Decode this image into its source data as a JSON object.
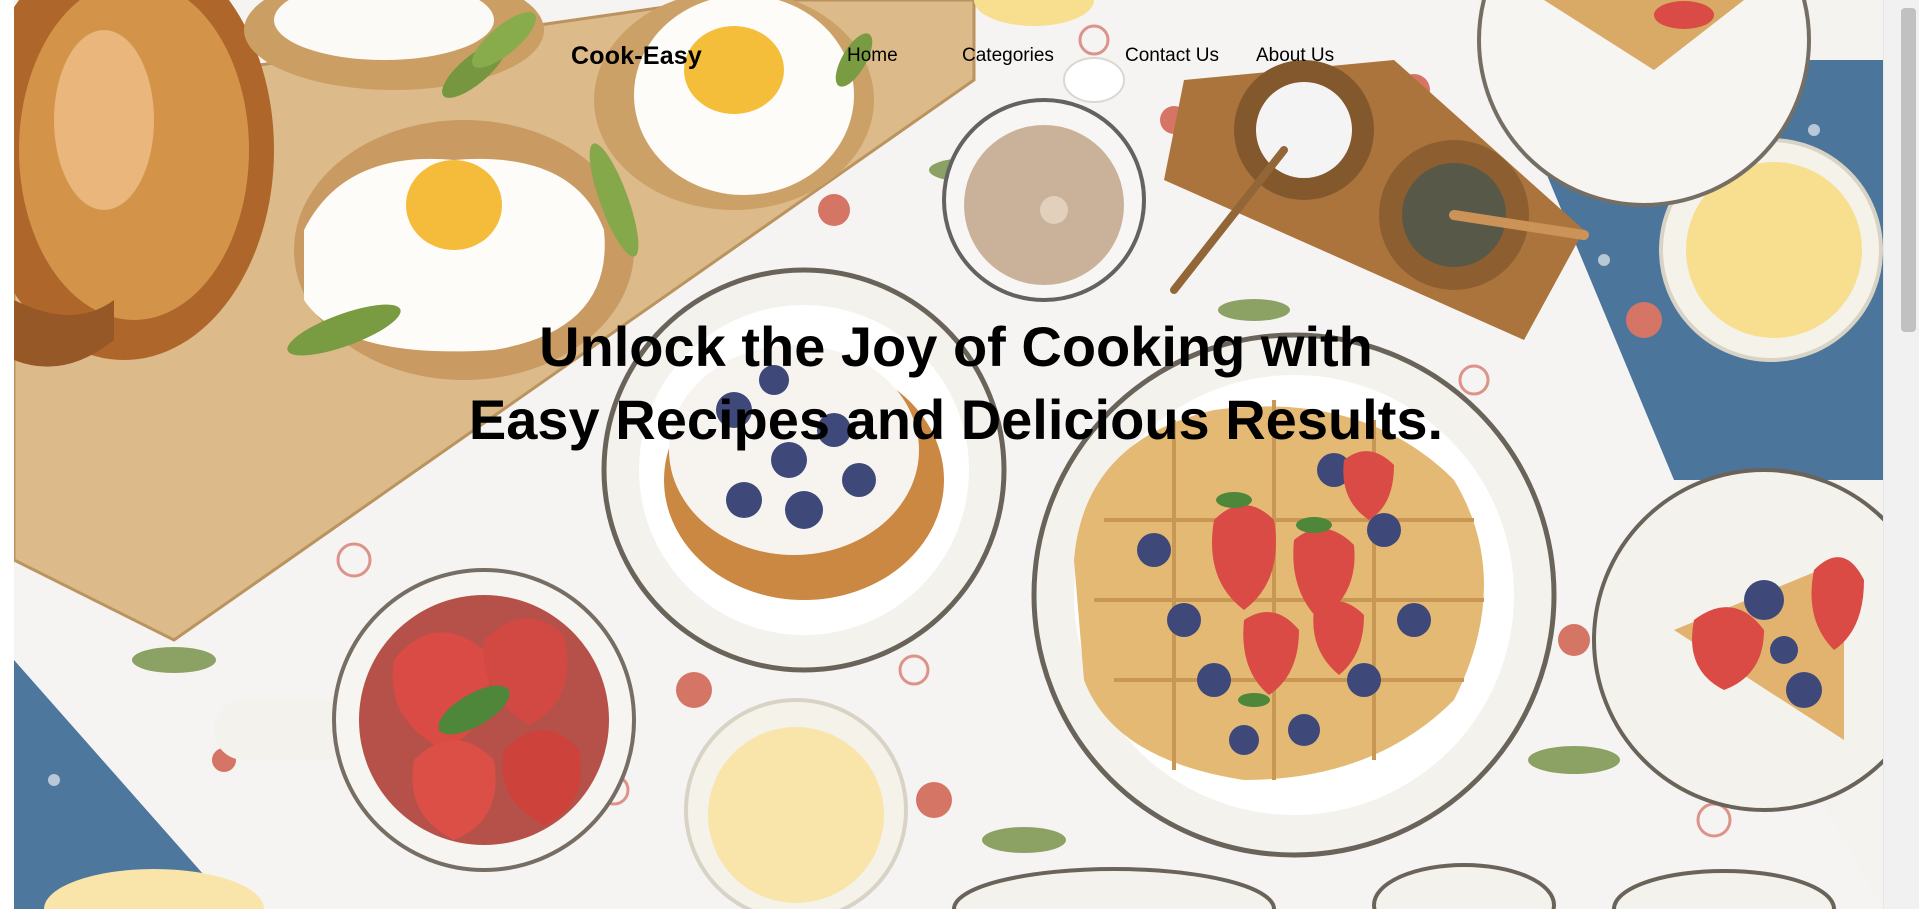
{
  "brand": {
    "name": "Cook-Easy"
  },
  "nav": {
    "home": "Home",
    "categories": "Categories",
    "contact": "Contact Us",
    "about": "About Us"
  },
  "hero": {
    "headline": "Unlock the Joy of Cooking with Easy Recipes and Delicious Results.",
    "background_icon": "breakfast-table-photo-icon"
  },
  "colors": {
    "text": "#000000",
    "tablecloth": "#f4f2ee",
    "wood": "#d8b47e",
    "denim": "#3d6a93",
    "berry": "#2e3a6e",
    "strawberry": "#d63c35",
    "yolk": "#f6c42b",
    "juice": "#f8dc86"
  }
}
